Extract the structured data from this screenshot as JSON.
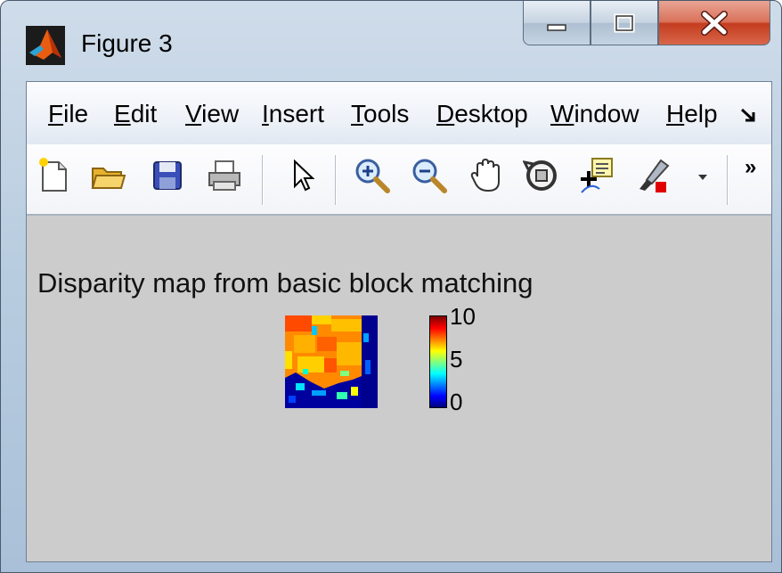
{
  "window": {
    "title": "Figure 3",
    "app_icon": "matlab-icon",
    "controls": [
      "minimize-icon",
      "maximize-icon",
      "close-icon"
    ]
  },
  "menubar": {
    "items": [
      {
        "label": "File",
        "mnemonic": "F",
        "rest": "ile"
      },
      {
        "label": "Edit",
        "mnemonic": "E",
        "rest": "dit"
      },
      {
        "label": "View",
        "mnemonic": "V",
        "rest": "iew"
      },
      {
        "label": "Insert",
        "mnemonic": "I",
        "rest": "nsert"
      },
      {
        "label": "Tools",
        "mnemonic": "T",
        "rest": "ools"
      },
      {
        "label": "Desktop",
        "mnemonic": "D",
        "rest": "esktop"
      },
      {
        "label": "Window",
        "mnemonic": "W",
        "rest": "indow"
      },
      {
        "label": "Help",
        "mnemonic": "H",
        "rest": "elp"
      }
    ],
    "overflow_icon": "dock-arrow-icon"
  },
  "toolbar": {
    "tools": [
      "new-figure-icon",
      "open-file-icon",
      "save-icon",
      "print-icon",
      "pointer-icon",
      "zoom-in-icon",
      "zoom-out-icon",
      "pan-hand-icon",
      "rotate-3d-icon",
      "data-cursor-icon",
      "brush-icon"
    ],
    "overflow_glyph": "»"
  },
  "figure": {
    "title": "Disparity map from basic block matching",
    "colorbar": {
      "ticks": [
        "10",
        "5",
        "0"
      ],
      "colormap": "jet"
    },
    "colors": {
      "background": "#cccccc"
    }
  }
}
